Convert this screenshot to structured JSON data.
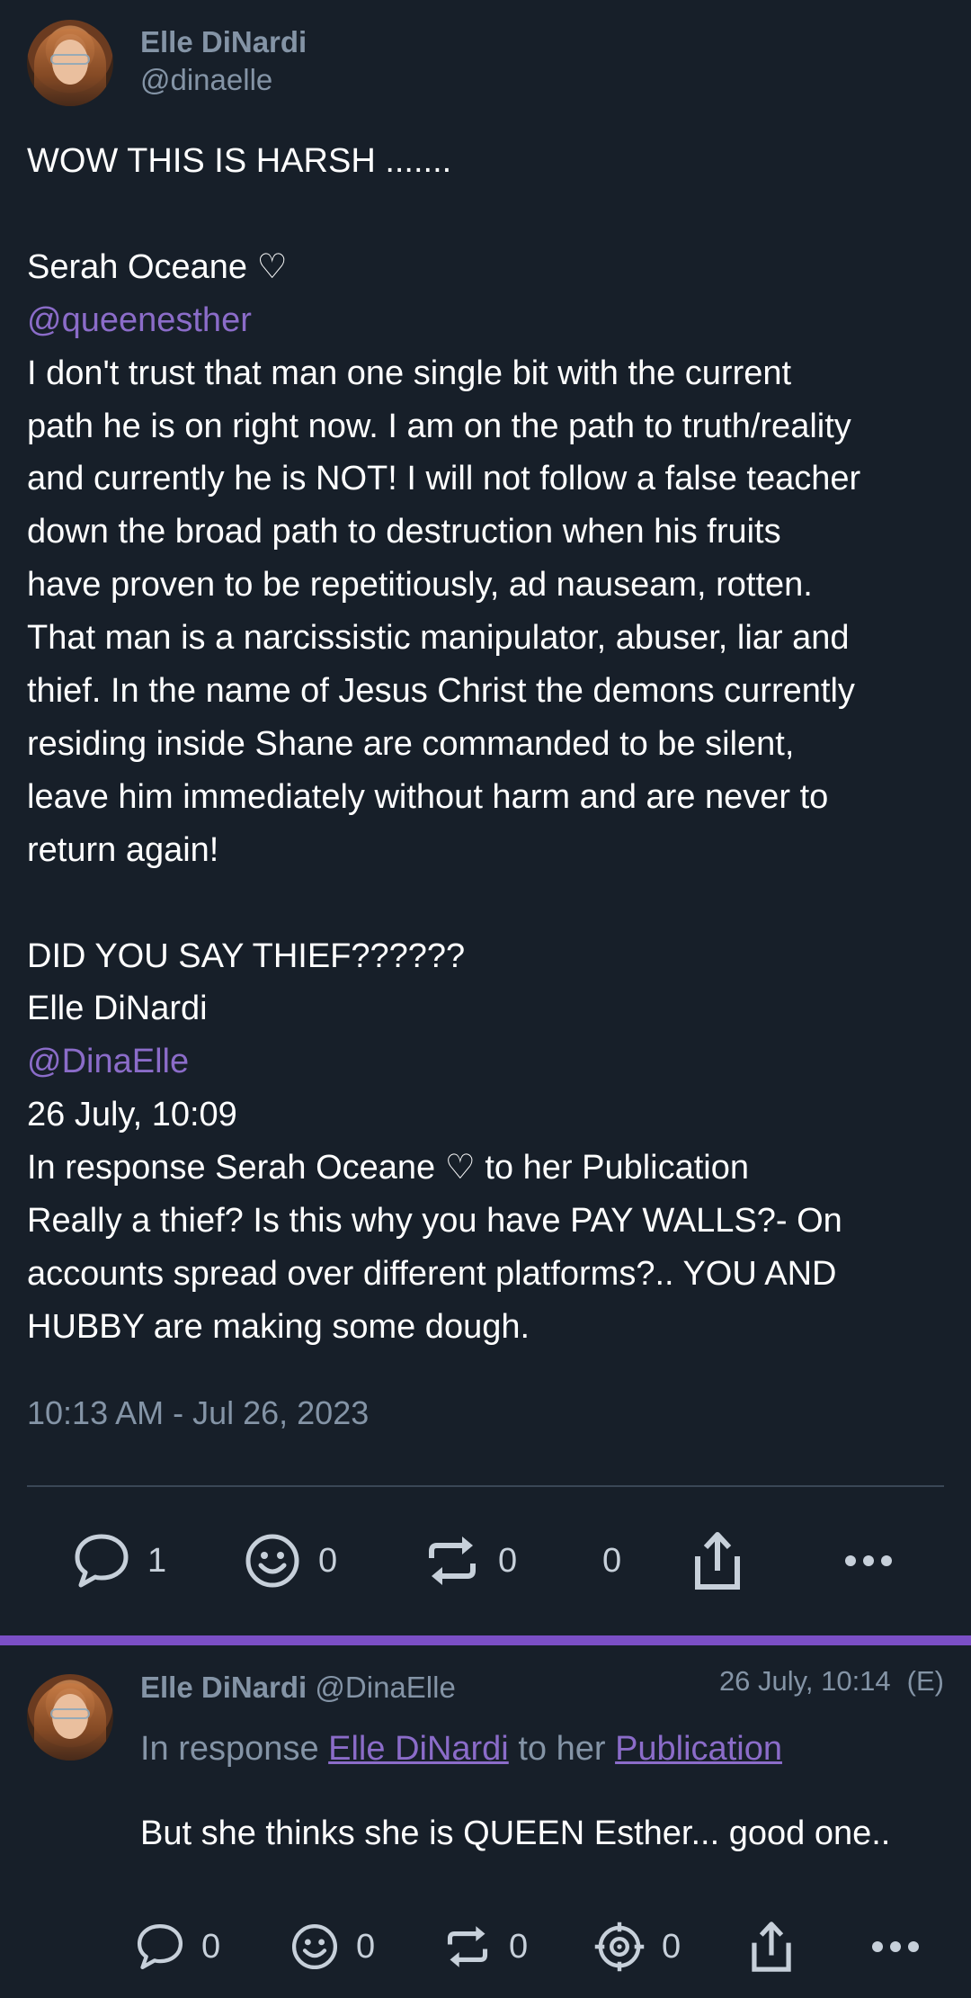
{
  "post": {
    "author_name": "Elle DiNardi",
    "author_handle": "@dinaelle",
    "lines": [
      {
        "text": "WOW THIS IS HARSH ......."
      },
      {
        "text": ""
      },
      {
        "text": "Serah Oceane ♡"
      },
      {
        "text": "@queenesther",
        "mention": true
      },
      {
        "text": "I don't trust that man one single bit with the current"
      },
      {
        "text": "path he is on right now. I am on the path to truth/reality"
      },
      {
        "text": "and currently he is NOT! I will not follow a false teacher"
      },
      {
        "text": "down the broad path to destruction when his fruits"
      },
      {
        "text": "have proven to be repetitiously, ad nauseam, rotten."
      },
      {
        "text": "That man is a narcissistic manipulator, abuser, liar and"
      },
      {
        "text": "thief. In the name of Jesus Christ the demons currently"
      },
      {
        "text": "residing inside Shane are commanded to be silent,"
      },
      {
        "text": "leave him immediately without harm and are never to"
      },
      {
        "text": "return again!"
      },
      {
        "text": ""
      },
      {
        "text": "DID YOU SAY THIEF??????"
      },
      {
        "text": "Elle DiNardi"
      },
      {
        "text": "@DinaElle",
        "mention": true
      },
      {
        "text": "26 July, 10:09"
      },
      {
        "text": "In response Serah Oceane ♡ to her Publication"
      },
      {
        "text": "Really a thief? Is this why you have PAY WALLS?- On"
      },
      {
        "text": "accounts spread over different platforms?.. YOU AND"
      },
      {
        "text": "HUBBY are making some dough."
      }
    ],
    "timestamp": "10:13 AM - Jul 26, 2023",
    "actions": {
      "replies": "1",
      "reactions": "0",
      "reposts": "0",
      "quotes": "0"
    }
  },
  "reply": {
    "author_name": "Elle DiNardi",
    "author_handle": "@DinaElle",
    "time": "26 July, 10:14",
    "edited": "(E)",
    "response_prefix": "In response",
    "response_user": "Elle DiNardi",
    "response_middle": "to her",
    "response_target": "Publication",
    "text": "But she thinks she is QUEEN Esther... good one..",
    "actions": {
      "replies": "0",
      "reactions": "0",
      "reposts": "0",
      "targets": "0"
    }
  },
  "colors": {
    "background": "#171f29",
    "accent": "#7b4fc6",
    "mention": "#8b6cc9",
    "muted": "#8494a6"
  },
  "icons": [
    "comment-icon",
    "smiley-icon",
    "repost-icon",
    "share-icon",
    "more-icon",
    "target-icon"
  ]
}
